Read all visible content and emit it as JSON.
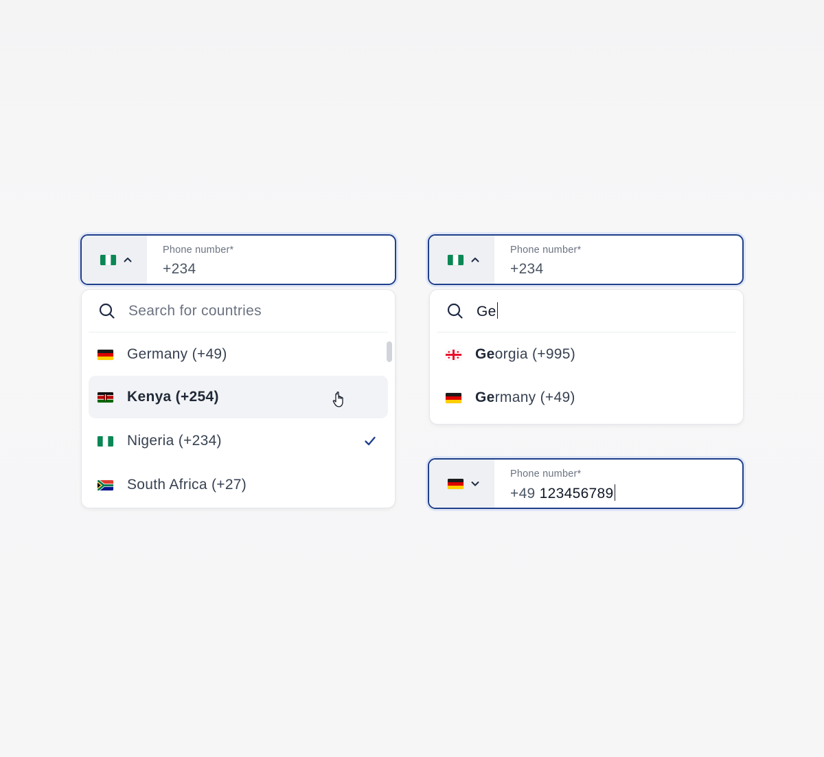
{
  "colors": {
    "focus_border": "#1f3f8a",
    "focus_ring": "#dfe6f5",
    "country_button_bg": "#eef0f4",
    "hover_row_bg": "#f2f3f6",
    "check": "#1f3f8a"
  },
  "field_left": {
    "flag": "nigeria-flag",
    "chevron": "chevron-up-icon",
    "label": "Phone number*",
    "value": "+234"
  },
  "dropdown_left": {
    "search_placeholder": "Search for countries",
    "options": [
      {
        "flag": "germany-flag",
        "label": "Germany (+49)",
        "state": "default"
      },
      {
        "flag": "kenya-flag",
        "label": "Kenya (+254)",
        "state": "hovered"
      },
      {
        "flag": "nigeria-flag",
        "label": "Nigeria (+234)",
        "state": "selected"
      },
      {
        "flag": "south-africa-flag",
        "label": "South Africa (+27)",
        "state": "default"
      }
    ]
  },
  "field_right": {
    "flag": "nigeria-flag",
    "chevron": "chevron-up-icon",
    "label": "Phone number*",
    "value": "+234"
  },
  "dropdown_right": {
    "search_value": "Ge",
    "options": [
      {
        "flag": "georgia-flag",
        "match": "Ge",
        "rest": "orgia (+995)"
      },
      {
        "flag": "germany-flag",
        "match": "Ge",
        "rest": "rmany (+49)"
      }
    ]
  },
  "field_bottom": {
    "flag": "germany-flag",
    "chevron": "chevron-down-icon",
    "label": "Phone number*",
    "dial_code": "+49",
    "number": "123456789"
  }
}
